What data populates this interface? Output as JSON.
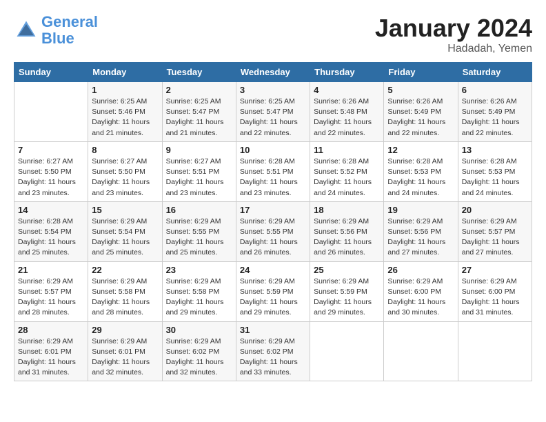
{
  "header": {
    "logo_line1": "General",
    "logo_line2": "Blue",
    "month": "January 2024",
    "location": "Hadadah, Yemen"
  },
  "weekdays": [
    "Sunday",
    "Monday",
    "Tuesday",
    "Wednesday",
    "Thursday",
    "Friday",
    "Saturday"
  ],
  "weeks": [
    [
      {
        "day": "",
        "sunrise": "",
        "sunset": "",
        "daylight": ""
      },
      {
        "day": "1",
        "sunrise": "6:25 AM",
        "sunset": "5:46 PM",
        "daylight": "11 hours and 21 minutes."
      },
      {
        "day": "2",
        "sunrise": "6:25 AM",
        "sunset": "5:47 PM",
        "daylight": "11 hours and 21 minutes."
      },
      {
        "day": "3",
        "sunrise": "6:25 AM",
        "sunset": "5:47 PM",
        "daylight": "11 hours and 22 minutes."
      },
      {
        "day": "4",
        "sunrise": "6:26 AM",
        "sunset": "5:48 PM",
        "daylight": "11 hours and 22 minutes."
      },
      {
        "day": "5",
        "sunrise": "6:26 AM",
        "sunset": "5:49 PM",
        "daylight": "11 hours and 22 minutes."
      },
      {
        "day": "6",
        "sunrise": "6:26 AM",
        "sunset": "5:49 PM",
        "daylight": "11 hours and 22 minutes."
      }
    ],
    [
      {
        "day": "7",
        "sunrise": "6:27 AM",
        "sunset": "5:50 PM",
        "daylight": "11 hours and 23 minutes."
      },
      {
        "day": "8",
        "sunrise": "6:27 AM",
        "sunset": "5:50 PM",
        "daylight": "11 hours and 23 minutes."
      },
      {
        "day": "9",
        "sunrise": "6:27 AM",
        "sunset": "5:51 PM",
        "daylight": "11 hours and 23 minutes."
      },
      {
        "day": "10",
        "sunrise": "6:28 AM",
        "sunset": "5:51 PM",
        "daylight": "11 hours and 23 minutes."
      },
      {
        "day": "11",
        "sunrise": "6:28 AM",
        "sunset": "5:52 PM",
        "daylight": "11 hours and 24 minutes."
      },
      {
        "day": "12",
        "sunrise": "6:28 AM",
        "sunset": "5:53 PM",
        "daylight": "11 hours and 24 minutes."
      },
      {
        "day": "13",
        "sunrise": "6:28 AM",
        "sunset": "5:53 PM",
        "daylight": "11 hours and 24 minutes."
      }
    ],
    [
      {
        "day": "14",
        "sunrise": "6:28 AM",
        "sunset": "5:54 PM",
        "daylight": "11 hours and 25 minutes."
      },
      {
        "day": "15",
        "sunrise": "6:29 AM",
        "sunset": "5:54 PM",
        "daylight": "11 hours and 25 minutes."
      },
      {
        "day": "16",
        "sunrise": "6:29 AM",
        "sunset": "5:55 PM",
        "daylight": "11 hours and 25 minutes."
      },
      {
        "day": "17",
        "sunrise": "6:29 AM",
        "sunset": "5:55 PM",
        "daylight": "11 hours and 26 minutes."
      },
      {
        "day": "18",
        "sunrise": "6:29 AM",
        "sunset": "5:56 PM",
        "daylight": "11 hours and 26 minutes."
      },
      {
        "day": "19",
        "sunrise": "6:29 AM",
        "sunset": "5:56 PM",
        "daylight": "11 hours and 27 minutes."
      },
      {
        "day": "20",
        "sunrise": "6:29 AM",
        "sunset": "5:57 PM",
        "daylight": "11 hours and 27 minutes."
      }
    ],
    [
      {
        "day": "21",
        "sunrise": "6:29 AM",
        "sunset": "5:57 PM",
        "daylight": "11 hours and 28 minutes."
      },
      {
        "day": "22",
        "sunrise": "6:29 AM",
        "sunset": "5:58 PM",
        "daylight": "11 hours and 28 minutes."
      },
      {
        "day": "23",
        "sunrise": "6:29 AM",
        "sunset": "5:58 PM",
        "daylight": "11 hours and 29 minutes."
      },
      {
        "day": "24",
        "sunrise": "6:29 AM",
        "sunset": "5:59 PM",
        "daylight": "11 hours and 29 minutes."
      },
      {
        "day": "25",
        "sunrise": "6:29 AM",
        "sunset": "5:59 PM",
        "daylight": "11 hours and 29 minutes."
      },
      {
        "day": "26",
        "sunrise": "6:29 AM",
        "sunset": "6:00 PM",
        "daylight": "11 hours and 30 minutes."
      },
      {
        "day": "27",
        "sunrise": "6:29 AM",
        "sunset": "6:00 PM",
        "daylight": "11 hours and 31 minutes."
      }
    ],
    [
      {
        "day": "28",
        "sunrise": "6:29 AM",
        "sunset": "6:01 PM",
        "daylight": "11 hours and 31 minutes."
      },
      {
        "day": "29",
        "sunrise": "6:29 AM",
        "sunset": "6:01 PM",
        "daylight": "11 hours and 32 minutes."
      },
      {
        "day": "30",
        "sunrise": "6:29 AM",
        "sunset": "6:02 PM",
        "daylight": "11 hours and 32 minutes."
      },
      {
        "day": "31",
        "sunrise": "6:29 AM",
        "sunset": "6:02 PM",
        "daylight": "11 hours and 33 minutes."
      },
      {
        "day": "",
        "sunrise": "",
        "sunset": "",
        "daylight": ""
      },
      {
        "day": "",
        "sunrise": "",
        "sunset": "",
        "daylight": ""
      },
      {
        "day": "",
        "sunrise": "",
        "sunset": "",
        "daylight": ""
      }
    ]
  ]
}
